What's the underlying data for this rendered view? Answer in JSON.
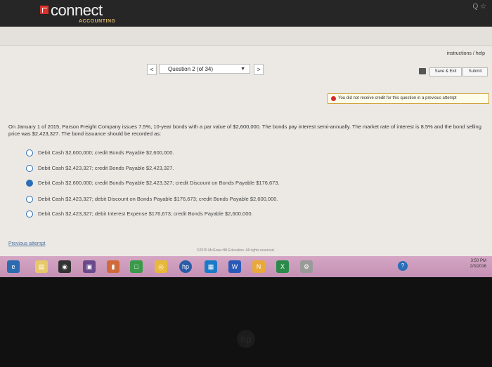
{
  "header": {
    "logo_text": "connect",
    "logo_sub": "ACCOUNTING",
    "top_icons": "Q ☆"
  },
  "toolbar": {
    "instructions": "instructions / help",
    "prev": "<",
    "question_label": "Question 2 (of 34)",
    "next": ">",
    "save_exit": "Save & Exit",
    "submit": "Submit"
  },
  "alert": {
    "text": "You did not receive credit for this question in a previous attempt"
  },
  "question": {
    "text": "On January 1 of 2015, Parson Freight Company issues 7.5%, 10-year bonds with a par value of $2,600,000. The bonds pay interest semi-annually. The market rate of interest is 8.5% and the bond selling price was $2,423,327. The bond issuance should be recorded as:",
    "options": [
      {
        "label": "Debit Cash $2,600,000; credit Bonds Payable $2,600,000.",
        "checked": false
      },
      {
        "label": "Debit Cash $2,423,327; credit Bonds Payable $2,423,327.",
        "checked": false
      },
      {
        "label": "Debit Cash $2,600,000; credit Bonds Payable $2,423,327; credit Discount on Bonds Payable $176,673.",
        "checked": true
      },
      {
        "label": "Debit Cash $2,423,327; debit Discount on Bonds Payable $176,673; credit Bonds Payable $2,600,000.",
        "checked": false
      },
      {
        "label": "Debit Cash $2,423,327; debit Interest Expense $176,673; credit Bonds Payable $2,600,000.",
        "checked": false
      }
    ]
  },
  "footer": {
    "previous_attempt": "Previous attempt",
    "copyright": "©2015 McGraw-Hill Education. All rights reserved."
  },
  "taskbar": {
    "time": "3:50 PM",
    "date": "2/3/2016",
    "help": "?"
  },
  "colors": {
    "accent": "#2a6db8",
    "alert_dot": "#d92a2a",
    "logo_red": "#d9302a"
  }
}
